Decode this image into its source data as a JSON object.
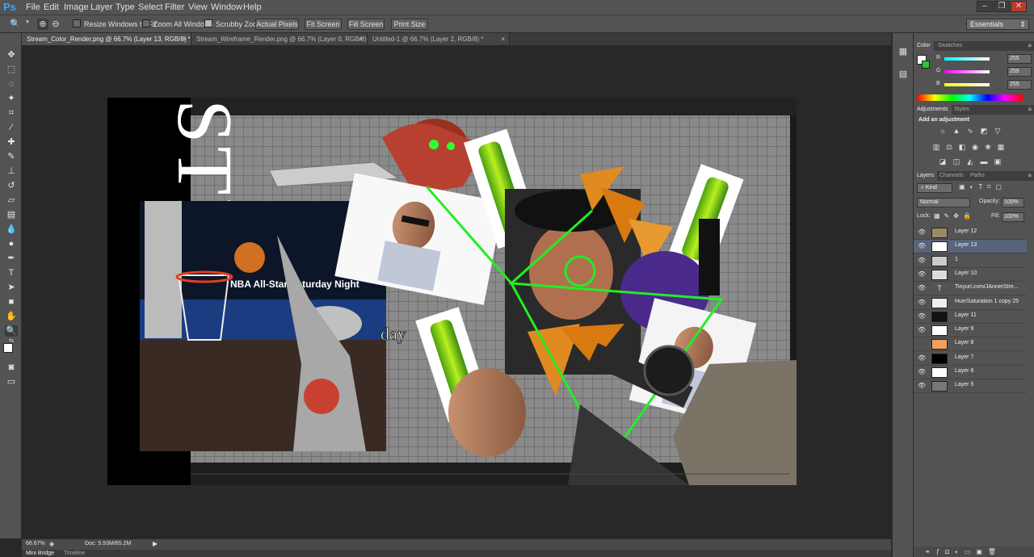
{
  "app": {
    "logo": "Ps"
  },
  "menu": [
    "File",
    "Edit",
    "Image",
    "Layer",
    "Type",
    "Select",
    "Filter",
    "View",
    "Window",
    "Help"
  ],
  "window_buttons": [
    "–",
    "❐",
    "✕"
  ],
  "options": {
    "resize_windows": "Resize Windows to Fit",
    "zoom_all": "Zoom All Windows",
    "scrubby_zoom": "Scrubby Zoom",
    "actual_pixels": "Actual Pixels",
    "fit_screen": "Fit Screen",
    "fill_screen": "Fill Screen",
    "print_size": "Print Size",
    "workspace": "Essentials"
  },
  "tabs": [
    {
      "label": "Stream_Color_Render.png @ 66.7% (Layer 13, RGB/8) *",
      "active": true
    },
    {
      "label": "Stream_Wireframe_Render.png @ 66.7% (Layer 0, RGB/8)",
      "active": false
    },
    {
      "label": "Untitled-1 @ 66.7% (Layer 2, RGB/8) *",
      "active": false
    }
  ],
  "tab_close": "×",
  "document": {
    "vertical_text": "STREAM",
    "overlay_text": "day",
    "nba_text": "NBA All-Star Saturday Night"
  },
  "color_panel": {
    "tabs": [
      "Color",
      "Swatches"
    ],
    "channels": [
      {
        "label": "R",
        "value": "255"
      },
      {
        "label": "G",
        "value": "255"
      },
      {
        "label": "B",
        "value": "255"
      }
    ]
  },
  "adjustments_panel": {
    "tabs": [
      "Adjustments",
      "Styles"
    ],
    "title": "Add an adjustment"
  },
  "layers_panel": {
    "tabs": [
      "Layers",
      "Channels",
      "Paths"
    ],
    "kind": "Kind",
    "blend_mode": "Normal",
    "opacity_label": "Opacity:",
    "opacity": "100%",
    "lock_label": "Lock:",
    "fill_label": "Fill:",
    "fill": "100%",
    "layers": [
      {
        "name": "Layer 12",
        "visible": true,
        "selected": false,
        "thumb": "#9a8a6a"
      },
      {
        "name": "Layer 13",
        "visible": true,
        "selected": true,
        "thumb": "#ffffff"
      },
      {
        "name": "1",
        "visible": true,
        "selected": false,
        "thumb": "#cccccc"
      },
      {
        "name": "Layer 10",
        "visible": true,
        "selected": false,
        "thumb": "#dddddd"
      },
      {
        "name": "Tinyurl.com/JAnnerStre...",
        "visible": true,
        "selected": false,
        "thumb": "text"
      },
      {
        "name": "Hue/Saturation 1 copy 25",
        "visible": true,
        "selected": false,
        "thumb": "#eeeeee"
      },
      {
        "name": "Layer 11",
        "visible": true,
        "selected": false,
        "thumb": "#111111"
      },
      {
        "name": "Layer 9",
        "visible": true,
        "selected": false,
        "thumb": "#ffffff"
      },
      {
        "name": "Layer 8",
        "visible": false,
        "selected": false,
        "thumb": "#f0a060"
      },
      {
        "name": "Layer 7",
        "visible": true,
        "selected": false,
        "thumb": "#000000"
      },
      {
        "name": "Layer 6",
        "visible": true,
        "selected": false,
        "thumb": "#ffffff"
      },
      {
        "name": "Layer 5",
        "visible": true,
        "selected": false,
        "thumb": "#777777"
      }
    ]
  },
  "status": {
    "zoom": "66.67%",
    "doc": "Doc: 5.93M/65.2M"
  },
  "bottom_tabs": [
    "Mini Bridge",
    "Timeline"
  ],
  "colors": {
    "foreground": "#ffffff",
    "background": "#22cc22",
    "accent": "#3fa3f4"
  }
}
